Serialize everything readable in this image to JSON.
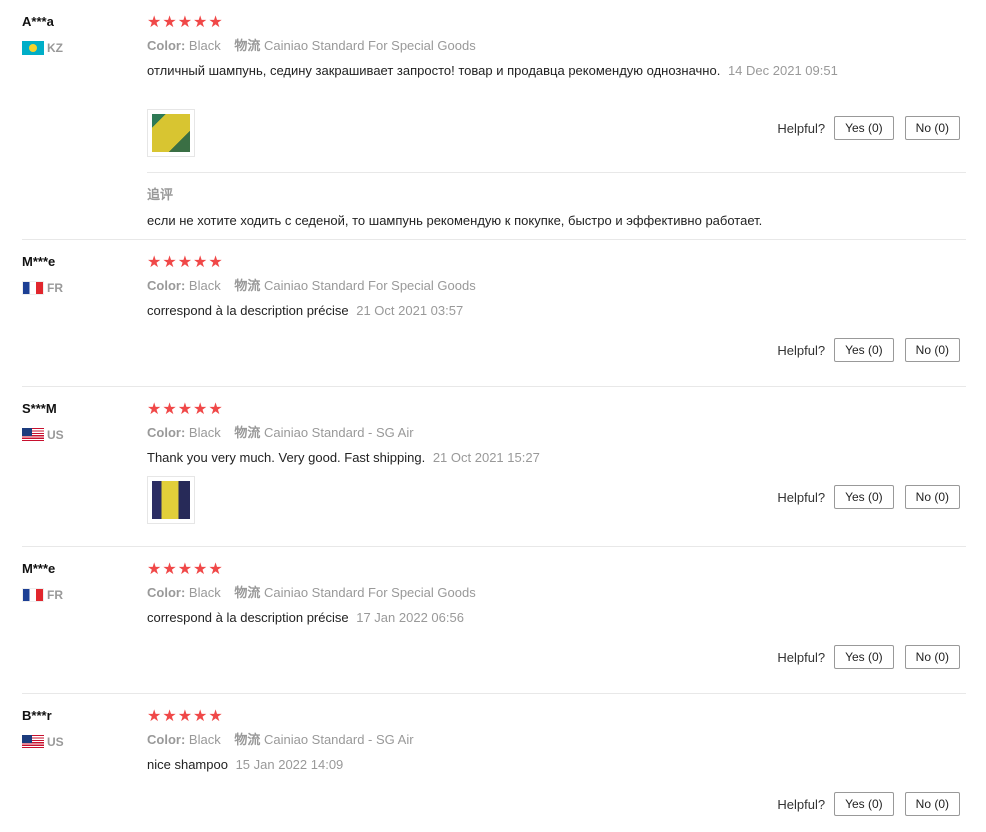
{
  "ui": {
    "helpful_label": "Helpful?",
    "color_label": "Color:",
    "shipping_label": "物流",
    "stars": "★★★★★"
  },
  "colors": {
    "star": "#f04848",
    "muted": "#999999"
  },
  "reviews": [
    {
      "user": "A***a",
      "country": "KZ",
      "flag_icon": "kazakhstan-flag-icon",
      "color": "Black",
      "shipping": "Cainiao Standard For Special Goods",
      "text": "отличный шампунь, седину закрашивает запросто! товар и продавца рекомендую однозначно.",
      "date": "14 Dec 2021 09:51",
      "yes": "Yes (0)",
      "no": "No (0)",
      "followup_title": "追评",
      "followup_text": "если не хотите ходить с седеной, то шампунь рекомендую к покупке, быстро и эффективно работает."
    },
    {
      "user": "M***e",
      "country": "FR",
      "flag_icon": "france-flag-icon",
      "color": "Black",
      "shipping": "Cainiao Standard For Special Goods",
      "text": "correspond à la description précise",
      "date": "21 Oct 2021 03:57",
      "yes": "Yes (0)",
      "no": "No (0)"
    },
    {
      "user": "S***M",
      "country": "US",
      "flag_icon": "usa-flag-icon",
      "color": "Black",
      "shipping": "Cainiao Standard - SG Air",
      "text": "Thank you very much. Very good. Fast shipping.",
      "date": "21 Oct 2021 15:27",
      "yes": "Yes (0)",
      "no": "No (0)"
    },
    {
      "user": "M***e",
      "country": "FR",
      "flag_icon": "france-flag-icon",
      "color": "Black",
      "shipping": "Cainiao Standard For Special Goods",
      "text": "correspond à la description précise",
      "date": "17 Jan 2022 06:56",
      "yes": "Yes (0)",
      "no": "No (0)"
    },
    {
      "user": "B***r",
      "country": "US",
      "flag_icon": "usa-flag-icon",
      "color": "Black",
      "shipping": "Cainiao Standard - SG Air",
      "text": "nice shampoo",
      "date": "15 Jan 2022 14:09",
      "yes": "Yes (0)",
      "no": "No (0)"
    }
  ]
}
